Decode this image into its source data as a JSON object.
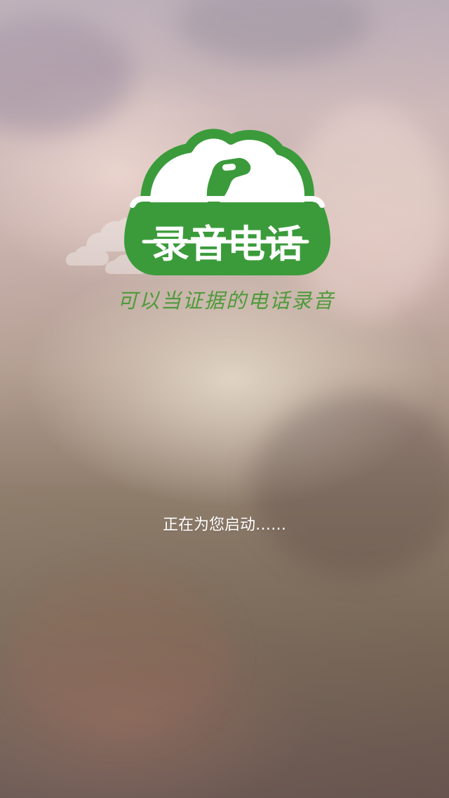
{
  "app": {
    "title": "录音电话",
    "tagline": "可以当证据的电话录音"
  },
  "status": {
    "loading_text": "正在为您启动……"
  },
  "theme": {
    "brand_green": "#3b9b3b",
    "text_white": "#ffffff"
  },
  "icons": {
    "logo": "cloud-phone-logo-icon",
    "small_clouds": "cloud-icon"
  }
}
